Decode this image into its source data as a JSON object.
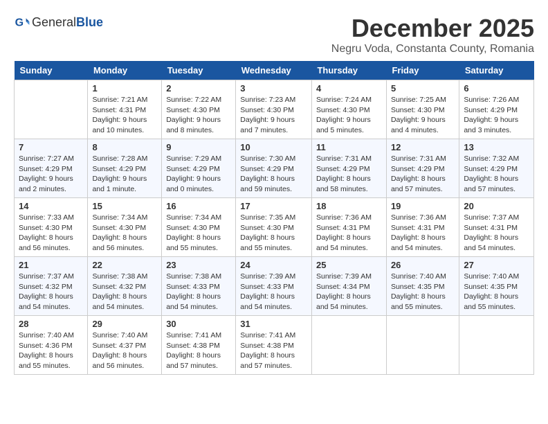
{
  "logo": {
    "general": "General",
    "blue": "Blue"
  },
  "header": {
    "month": "December 2025",
    "location": "Negru Voda, Constanta County, Romania"
  },
  "days_of_week": [
    "Sunday",
    "Monday",
    "Tuesday",
    "Wednesday",
    "Thursday",
    "Friday",
    "Saturday"
  ],
  "weeks": [
    [
      {
        "day": "",
        "info": ""
      },
      {
        "day": "1",
        "info": "Sunrise: 7:21 AM\nSunset: 4:31 PM\nDaylight: 9 hours\nand 10 minutes."
      },
      {
        "day": "2",
        "info": "Sunrise: 7:22 AM\nSunset: 4:30 PM\nDaylight: 9 hours\nand 8 minutes."
      },
      {
        "day": "3",
        "info": "Sunrise: 7:23 AM\nSunset: 4:30 PM\nDaylight: 9 hours\nand 7 minutes."
      },
      {
        "day": "4",
        "info": "Sunrise: 7:24 AM\nSunset: 4:30 PM\nDaylight: 9 hours\nand 5 minutes."
      },
      {
        "day": "5",
        "info": "Sunrise: 7:25 AM\nSunset: 4:30 PM\nDaylight: 9 hours\nand 4 minutes."
      },
      {
        "day": "6",
        "info": "Sunrise: 7:26 AM\nSunset: 4:29 PM\nDaylight: 9 hours\nand 3 minutes."
      }
    ],
    [
      {
        "day": "7",
        "info": "Sunrise: 7:27 AM\nSunset: 4:29 PM\nDaylight: 9 hours\nand 2 minutes."
      },
      {
        "day": "8",
        "info": "Sunrise: 7:28 AM\nSunset: 4:29 PM\nDaylight: 9 hours\nand 1 minute."
      },
      {
        "day": "9",
        "info": "Sunrise: 7:29 AM\nSunset: 4:29 PM\nDaylight: 9 hours\nand 0 minutes."
      },
      {
        "day": "10",
        "info": "Sunrise: 7:30 AM\nSunset: 4:29 PM\nDaylight: 8 hours\nand 59 minutes."
      },
      {
        "day": "11",
        "info": "Sunrise: 7:31 AM\nSunset: 4:29 PM\nDaylight: 8 hours\nand 58 minutes."
      },
      {
        "day": "12",
        "info": "Sunrise: 7:31 AM\nSunset: 4:29 PM\nDaylight: 8 hours\nand 57 minutes."
      },
      {
        "day": "13",
        "info": "Sunrise: 7:32 AM\nSunset: 4:29 PM\nDaylight: 8 hours\nand 57 minutes."
      }
    ],
    [
      {
        "day": "14",
        "info": "Sunrise: 7:33 AM\nSunset: 4:30 PM\nDaylight: 8 hours\nand 56 minutes."
      },
      {
        "day": "15",
        "info": "Sunrise: 7:34 AM\nSunset: 4:30 PM\nDaylight: 8 hours\nand 56 minutes."
      },
      {
        "day": "16",
        "info": "Sunrise: 7:34 AM\nSunset: 4:30 PM\nDaylight: 8 hours\nand 55 minutes."
      },
      {
        "day": "17",
        "info": "Sunrise: 7:35 AM\nSunset: 4:30 PM\nDaylight: 8 hours\nand 55 minutes."
      },
      {
        "day": "18",
        "info": "Sunrise: 7:36 AM\nSunset: 4:31 PM\nDaylight: 8 hours\nand 54 minutes."
      },
      {
        "day": "19",
        "info": "Sunrise: 7:36 AM\nSunset: 4:31 PM\nDaylight: 8 hours\nand 54 minutes."
      },
      {
        "day": "20",
        "info": "Sunrise: 7:37 AM\nSunset: 4:31 PM\nDaylight: 8 hours\nand 54 minutes."
      }
    ],
    [
      {
        "day": "21",
        "info": "Sunrise: 7:37 AM\nSunset: 4:32 PM\nDaylight: 8 hours\nand 54 minutes."
      },
      {
        "day": "22",
        "info": "Sunrise: 7:38 AM\nSunset: 4:32 PM\nDaylight: 8 hours\nand 54 minutes."
      },
      {
        "day": "23",
        "info": "Sunrise: 7:38 AM\nSunset: 4:33 PM\nDaylight: 8 hours\nand 54 minutes."
      },
      {
        "day": "24",
        "info": "Sunrise: 7:39 AM\nSunset: 4:33 PM\nDaylight: 8 hours\nand 54 minutes."
      },
      {
        "day": "25",
        "info": "Sunrise: 7:39 AM\nSunset: 4:34 PM\nDaylight: 8 hours\nand 54 minutes."
      },
      {
        "day": "26",
        "info": "Sunrise: 7:40 AM\nSunset: 4:35 PM\nDaylight: 8 hours\nand 55 minutes."
      },
      {
        "day": "27",
        "info": "Sunrise: 7:40 AM\nSunset: 4:35 PM\nDaylight: 8 hours\nand 55 minutes."
      }
    ],
    [
      {
        "day": "28",
        "info": "Sunrise: 7:40 AM\nSunset: 4:36 PM\nDaylight: 8 hours\nand 55 minutes."
      },
      {
        "day": "29",
        "info": "Sunrise: 7:40 AM\nSunset: 4:37 PM\nDaylight: 8 hours\nand 56 minutes."
      },
      {
        "day": "30",
        "info": "Sunrise: 7:41 AM\nSunset: 4:38 PM\nDaylight: 8 hours\nand 57 minutes."
      },
      {
        "day": "31",
        "info": "Sunrise: 7:41 AM\nSunset: 4:38 PM\nDaylight: 8 hours\nand 57 minutes."
      },
      {
        "day": "",
        "info": ""
      },
      {
        "day": "",
        "info": ""
      },
      {
        "day": "",
        "info": ""
      }
    ]
  ]
}
